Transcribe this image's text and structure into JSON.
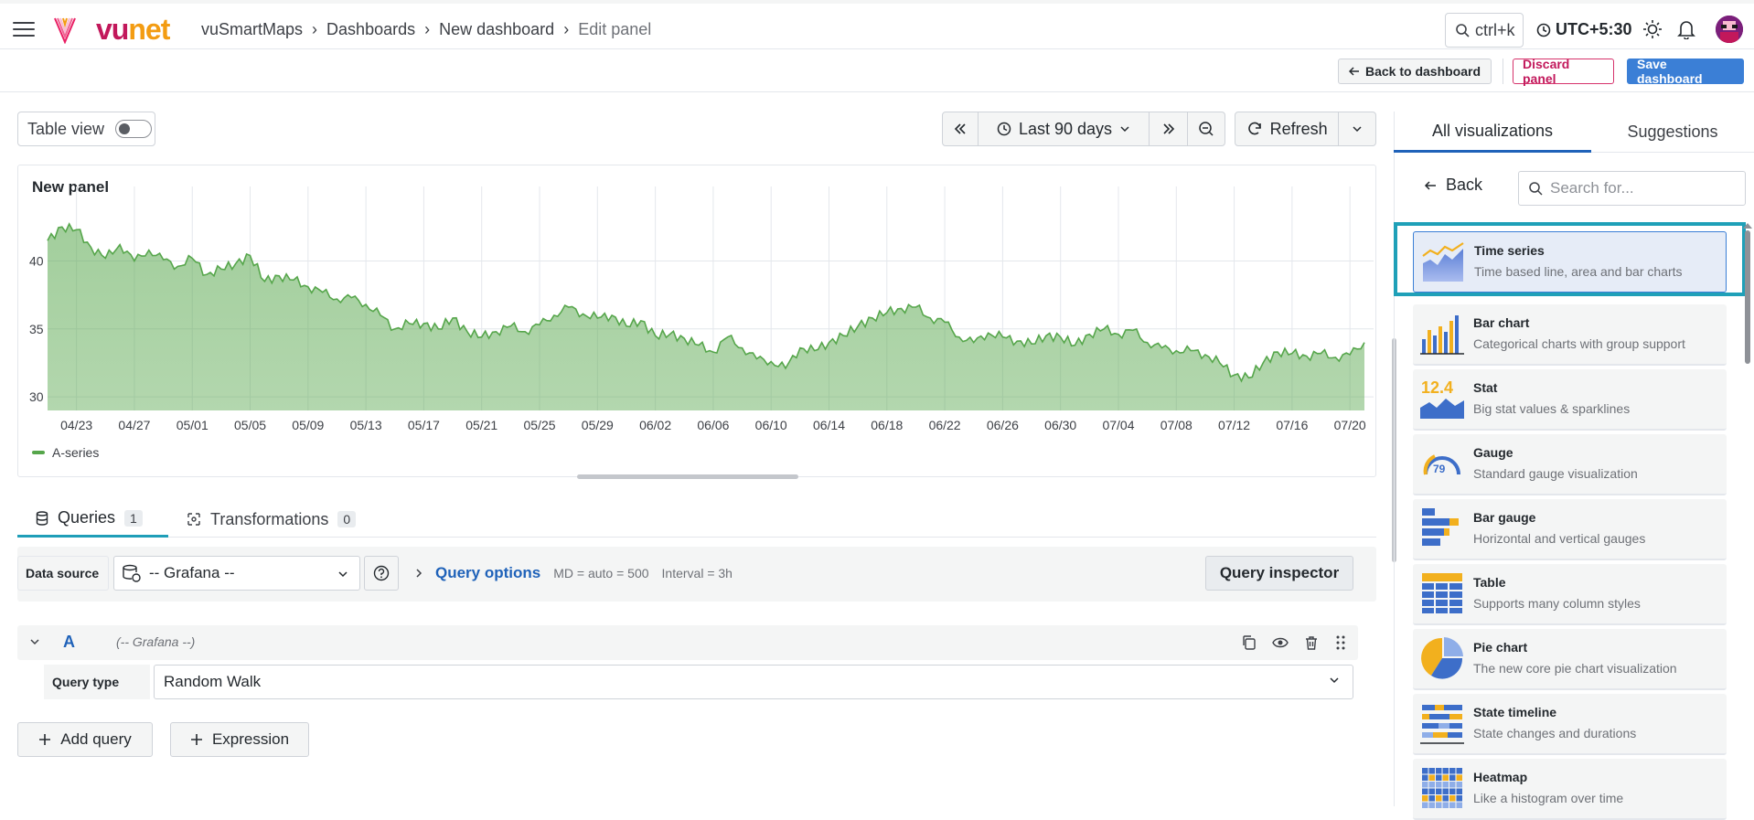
{
  "header": {
    "logo_text": "vunet",
    "breadcrumb": [
      "vuSmartMaps",
      "Dashboards",
      "New dashboard",
      "Edit panel"
    ],
    "search_shortcut": "ctrl+k",
    "timezone": "UTC+5:30"
  },
  "toolbar": {
    "back_label": "Back to dashboard",
    "discard_label": "Discard panel",
    "save_label": "Save dashboard"
  },
  "controls": {
    "table_view_label": "Table view",
    "table_view_on": false,
    "time_range": "Last 90 days",
    "refresh_label": "Refresh"
  },
  "panel": {
    "title": "New panel",
    "legend": "A-series"
  },
  "chart_data": {
    "type": "area",
    "title": "New panel",
    "series": [
      {
        "name": "A-series",
        "x": [
          "04/21",
          "04/22",
          "04/23",
          "04/24",
          "04/25",
          "04/26",
          "04/27",
          "04/28",
          "04/29",
          "04/30",
          "05/01",
          "05/02",
          "05/03",
          "05/04",
          "05/05",
          "05/06",
          "05/07",
          "05/08",
          "05/09",
          "05/10",
          "05/11",
          "05/12",
          "05/13",
          "05/14",
          "05/15",
          "05/16",
          "05/17",
          "05/18",
          "05/19",
          "05/20",
          "05/21",
          "05/22",
          "05/23",
          "05/24",
          "05/25",
          "05/26",
          "05/27",
          "05/28",
          "05/29",
          "05/30",
          "05/31",
          "06/01",
          "06/02",
          "06/03",
          "06/04",
          "06/05",
          "06/06",
          "06/07",
          "06/08",
          "06/09",
          "06/10",
          "06/11",
          "06/12",
          "06/13",
          "06/14",
          "06/15",
          "06/16",
          "06/17",
          "06/18",
          "06/19",
          "06/20",
          "06/21",
          "06/22",
          "06/23",
          "06/24",
          "06/25",
          "06/26",
          "06/27",
          "06/28",
          "06/29",
          "06/30",
          "07/01",
          "07/02",
          "07/03",
          "07/04",
          "07/05",
          "07/06",
          "07/07",
          "07/08",
          "07/09",
          "07/10",
          "07/11",
          "07/12",
          "07/13",
          "07/14",
          "07/15",
          "07/16",
          "07/17",
          "07/18",
          "07/19",
          "07/20",
          "07/21"
        ],
        "values": [
          41.5,
          42.5,
          42.3,
          41.0,
          40.2,
          41.2,
          40.0,
          40.8,
          40.1,
          39.6,
          40.2,
          39.0,
          39.4,
          39.8,
          40.4,
          38.5,
          38.9,
          38.6,
          38.1,
          37.7,
          37.2,
          37.3,
          36.8,
          36.0,
          35.0,
          35.4,
          35.4,
          35.0,
          35.8,
          34.8,
          34.4,
          34.8,
          35.2,
          34.8,
          35.3,
          36.0,
          36.6,
          36.1,
          35.8,
          36.0,
          35.2,
          35.6,
          34.5,
          34.6,
          34.3,
          33.8,
          33.3,
          34.4,
          33.6,
          32.8,
          32.6,
          32.1,
          33.6,
          33.4,
          34.0,
          34.5,
          35.2,
          35.8,
          36.2,
          36.5,
          36.6,
          35.8,
          35.5,
          34.4,
          34.0,
          34.7,
          34.4,
          34.1,
          33.9,
          34.5,
          34.4,
          33.8,
          34.6,
          35.0,
          34.6,
          34.9,
          34.0,
          33.6,
          33.4,
          33.4,
          33.1,
          32.5,
          31.6,
          31.4,
          32.5,
          33.3,
          33.2,
          33.0,
          33.2,
          32.9,
          33.1,
          34.0
        ]
      }
    ],
    "xticks": [
      "04/23",
      "04/27",
      "05/01",
      "05/05",
      "05/09",
      "05/13",
      "05/17",
      "05/21",
      "05/25",
      "05/29",
      "06/02",
      "06/06",
      "06/10",
      "06/14",
      "06/18",
      "06/22",
      "06/26",
      "06/30",
      "07/04",
      "07/08",
      "07/12",
      "07/16",
      "07/20"
    ],
    "yticks": [
      30,
      35,
      40
    ],
    "ylim": [
      29,
      44
    ],
    "grid": true,
    "legend": "bottom-left",
    "color": "#56a64b"
  },
  "query_tabs": [
    {
      "label": "Queries",
      "count": "1"
    },
    {
      "label": "Transformations",
      "count": "0"
    }
  ],
  "query_editor": {
    "datasource_label": "Data source",
    "datasource_value": "-- Grafana --",
    "options_title": "Query options",
    "options_md": "MD = auto = 500",
    "options_interval": "Interval = 3h",
    "inspector_label": "Query inspector",
    "query_letter": "A",
    "query_ds": "(-- Grafana --)",
    "query_type_label": "Query type",
    "query_type_value": "Random Walk",
    "add_query_label": "Add query",
    "expression_label": "Expression"
  },
  "viz_panel": {
    "tabs": [
      "All visualizations",
      "Suggestions"
    ],
    "back_label": "Back",
    "search_placeholder": "Search for...",
    "items": [
      {
        "name": "Time series",
        "desc": "Time based line, area and bar charts"
      },
      {
        "name": "Bar chart",
        "desc": "Categorical charts with group support"
      },
      {
        "name": "Stat",
        "desc": "Big stat values & sparklines"
      },
      {
        "name": "Gauge",
        "desc": "Standard gauge visualization"
      },
      {
        "name": "Bar gauge",
        "desc": "Horizontal and vertical gauges"
      },
      {
        "name": "Table",
        "desc": "Supports many column styles"
      },
      {
        "name": "Pie chart",
        "desc": "The new core pie chart visualization"
      },
      {
        "name": "State timeline",
        "desc": "State changes and durations"
      },
      {
        "name": "Heatmap",
        "desc": "Like a histogram over time"
      }
    ],
    "stat_thumb_value": "12.4",
    "gauge_thumb_value": "79"
  },
  "colors": {
    "accent_blue": "#3b7fd6",
    "brand_pink": "#c2185b",
    "highlight": "#1fa0b8",
    "series_green": "#56a64b"
  }
}
